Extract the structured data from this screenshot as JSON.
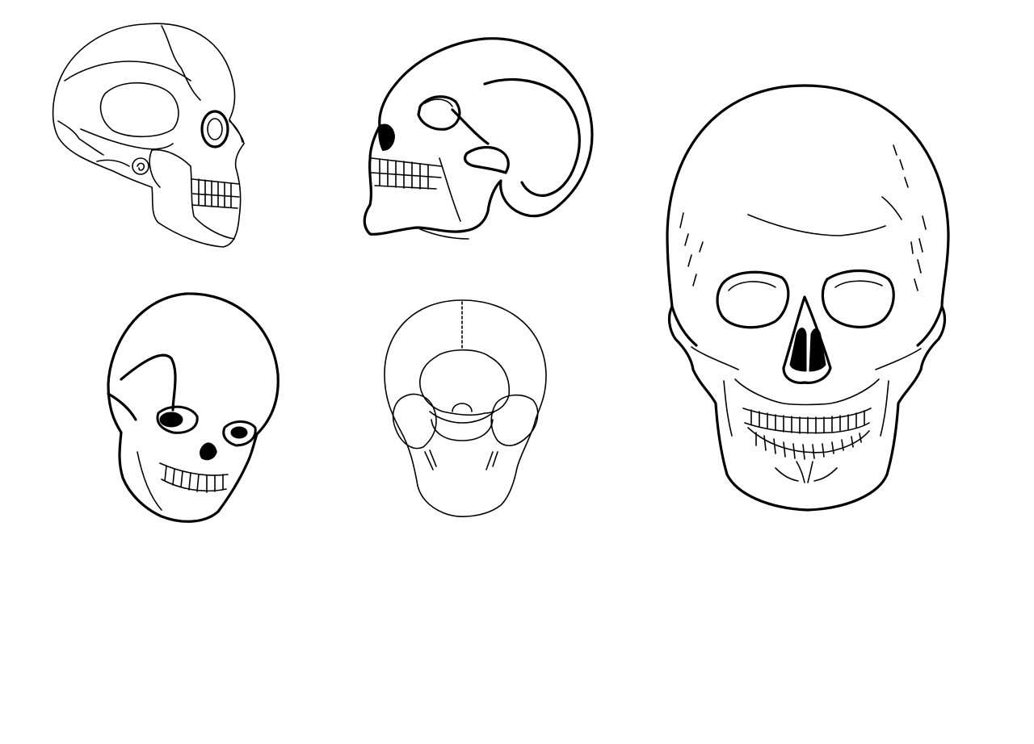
{
  "canvas": {
    "background": "#ffffff",
    "ink": "#000000"
  },
  "figures": [
    {
      "view": "left-profile"
    },
    {
      "view": "right-profile-tilted"
    },
    {
      "view": "three-quarter-front"
    },
    {
      "view": "rear"
    },
    {
      "view": "front"
    }
  ]
}
